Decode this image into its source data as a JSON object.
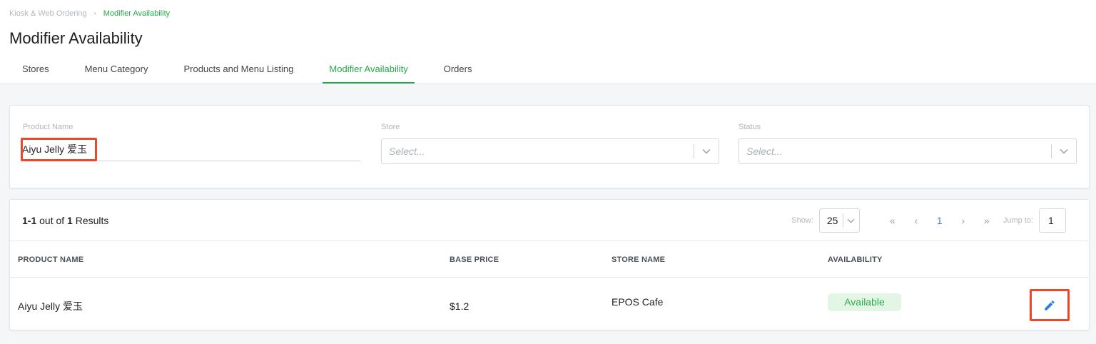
{
  "breadcrumb": {
    "parent": "Kiosk & Web Ordering",
    "separator": "•",
    "current": "Modifier Availability"
  },
  "page": {
    "title": "Modifier Availability"
  },
  "tabs": [
    {
      "label": "Stores"
    },
    {
      "label": "Menu Category"
    },
    {
      "label": "Products and Menu Listing"
    },
    {
      "label": "Modifier Availability",
      "active": true
    },
    {
      "label": "Orders"
    }
  ],
  "filters": {
    "product_name": {
      "label": "Product Name",
      "value": "Aiyu Jelly 爱玉"
    },
    "store": {
      "label": "Store",
      "placeholder": "Select..."
    },
    "status": {
      "label": "Status",
      "placeholder": "Select..."
    }
  },
  "results": {
    "range": "1-1",
    "out_of_text": " out of ",
    "total": "1",
    "suffix": " Results"
  },
  "pagination": {
    "show_label": "Show:",
    "page_size": "25",
    "first": "«",
    "prev": "‹",
    "current_page": "1",
    "next": "›",
    "last": "»",
    "jump_label": "Jump to:",
    "jump_value": "1"
  },
  "table": {
    "headers": {
      "product_name": "PRODUCT NAME",
      "base_price": "BASE PRICE",
      "store_name": "STORE NAME",
      "availability": "AVAILABILITY"
    },
    "rows": [
      {
        "product_name": "Aiyu Jelly 爱玉",
        "base_price": "$1.2",
        "store_name": "EPOS Cafe",
        "availability": "Available"
      }
    ]
  },
  "colors": {
    "accent": "#27a84a",
    "link": "#2f7ee8",
    "highlight": "#e8482c",
    "badge_bg": "#e3f6e6"
  },
  "icons": {
    "edit": "pencil-icon",
    "dropdown": "chevron-down-icon"
  }
}
